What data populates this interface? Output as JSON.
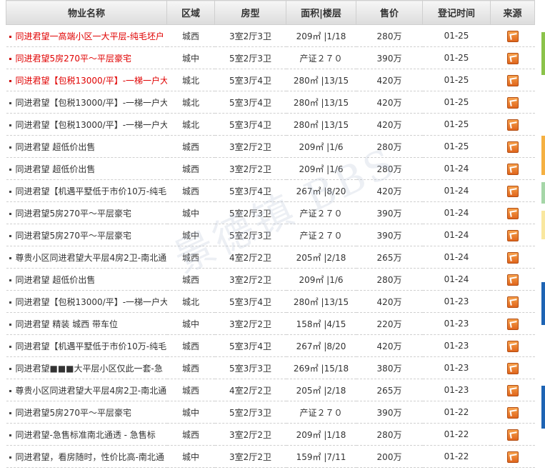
{
  "headers": [
    "物业名称",
    "区域",
    "房型",
    "面积|楼层",
    "售价",
    "登记时间",
    "来源"
  ],
  "rows": [
    {
      "name": "同进君望一高端小区一大平层-纯毛坯户",
      "area": "城西",
      "type": "3室2厅3卫",
      "size": "209㎡ |1/18",
      "price": "280万",
      "date": "01-25",
      "hot": true
    },
    {
      "name": "同进君望5房270平～平层豪宅",
      "area": "城中",
      "type": "5室2厅3卫",
      "size": "产证２７０",
      "price": "390万",
      "date": "01-25",
      "hot": true
    },
    {
      "name": "同进君望【包税13000/平】-一梯一户大",
      "area": "城北",
      "type": "5室3厅4卫",
      "size": "280㎡ |13/15",
      "price": "420万",
      "date": "01-25",
      "hot": true
    },
    {
      "name": "同进君望【包税13000/平】-一梯一户大",
      "area": "城北",
      "type": "5室3厅4卫",
      "size": "280㎡ |13/15",
      "price": "420万",
      "date": "01-25",
      "hot": false
    },
    {
      "name": "同进君望【包税13000/平】-一梯一户大",
      "area": "城北",
      "type": "5室3厅4卫",
      "size": "280㎡ |13/15",
      "price": "420万",
      "date": "01-25",
      "hot": false
    },
    {
      "name": "同进君望 超低价出售",
      "area": "城西",
      "type": "3室2厅2卫",
      "size": "209㎡ |1/6",
      "price": "280万",
      "date": "01-25",
      "hot": false
    },
    {
      "name": "同进君望 超低价出售",
      "area": "城西",
      "type": "3室2厅2卫",
      "size": "209㎡ |1/6",
      "price": "280万",
      "date": "01-24",
      "hot": false
    },
    {
      "name": "同进君望【机遇平墅低于市价10万-纯毛",
      "area": "城西",
      "type": "5室3厅4卫",
      "size": "267㎡ |8/20",
      "price": "420万",
      "date": "01-24",
      "hot": false
    },
    {
      "name": "同进君望5房270平～平层豪宅",
      "area": "城中",
      "type": "5室2厅3卫",
      "size": "产证２７０",
      "price": "390万",
      "date": "01-24",
      "hot": false
    },
    {
      "name": "同进君望5房270平～平层豪宅",
      "area": "城中",
      "type": "5室2厅3卫",
      "size": "产证２７０",
      "price": "390万",
      "date": "01-24",
      "hot": false
    },
    {
      "name": "尊贵小区同进君望大平层4房2卫-南北通",
      "area": "城西",
      "type": "4室2厅2卫",
      "size": "205㎡ |2/18",
      "price": "265万",
      "date": "01-24",
      "hot": false
    },
    {
      "name": "同进君望 超低价出售",
      "area": "城西",
      "type": "3室2厅2卫",
      "size": "209㎡ |1/6",
      "price": "280万",
      "date": "01-24",
      "hot": false
    },
    {
      "name": "同进君望【包税13000/平】-一梯一户大",
      "area": "城北",
      "type": "5室3厅4卫",
      "size": "280㎡ |13/15",
      "price": "420万",
      "date": "01-23",
      "hot": false
    },
    {
      "name": "同进君望 精装 城西 带车位",
      "area": "城中",
      "type": "3室2厅2卫",
      "size": "158㎡ |4/15",
      "price": "220万",
      "date": "01-23",
      "hot": false
    },
    {
      "name": "同进君望【机遇平墅低于市价10万-纯毛",
      "area": "城西",
      "type": "5室3厅4卫",
      "size": "267㎡ |8/20",
      "price": "420万",
      "date": "01-23",
      "hot": false
    },
    {
      "name": "同进君望■■■大平层小区仅此一套-急",
      "area": "城西",
      "type": "5室3厅3卫",
      "size": "269㎡ |15/18",
      "price": "380万",
      "date": "01-23",
      "hot": false
    },
    {
      "name": "尊贵小区同进君望大平层4房2卫-南北通",
      "area": "城西",
      "type": "4室2厅2卫",
      "size": "205㎡ |2/18",
      "price": "265万",
      "date": "01-23",
      "hot": false
    },
    {
      "name": "同进君望5房270平～平层豪宅",
      "area": "城中",
      "type": "5室2厅3卫",
      "size": "产证２７０",
      "price": "390万",
      "date": "01-22",
      "hot": false
    },
    {
      "name": "同进君望-急售标准南北通透 - 急售标",
      "area": "城西",
      "type": "3室2厅2卫",
      "size": "209㎡ |1/18",
      "price": "280万",
      "date": "01-22",
      "hot": false
    },
    {
      "name": "同进君望，看房随时，性价比高-南北通",
      "area": "城中",
      "type": "3室2厅2卫",
      "size": "159㎡ |7/11",
      "price": "200万",
      "date": "01-22",
      "hot": false
    }
  ],
  "watermark": "景德镇 BBS"
}
